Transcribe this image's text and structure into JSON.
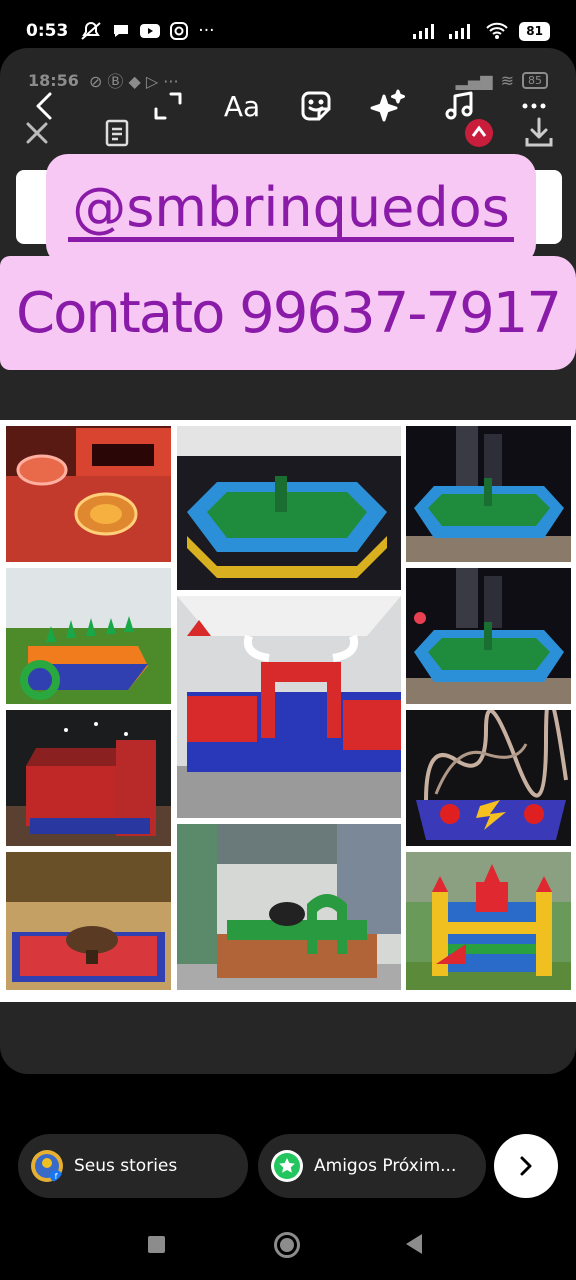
{
  "status_bar": {
    "time": "0:53",
    "battery": "81"
  },
  "inner_status": {
    "time": "18:56",
    "battery": "85"
  },
  "editor": {
    "text_tool_label": "Aa"
  },
  "stickers": {
    "handle": "@smbrinquedos",
    "contact": "Contato 99637-7917"
  },
  "share_bar": {
    "your_stories_label": "Seus stories",
    "close_friends_label": "Amigos Próxim..."
  },
  "icons": {
    "back": "chevron-left-icon",
    "expand": "expand-icon",
    "sticker": "sticker-icon",
    "effects": "sparkles-icon",
    "music": "music-icon",
    "more": "more-icon",
    "close": "close-icon",
    "note": "note-icon",
    "download": "download-icon",
    "next": "chevron-right-icon"
  },
  "colors": {
    "sticker_bg": "#f8c8f4",
    "sticker_text": "#8a1aa8",
    "panel_bg": "#262626",
    "close_friends_green": "#22c55e"
  }
}
